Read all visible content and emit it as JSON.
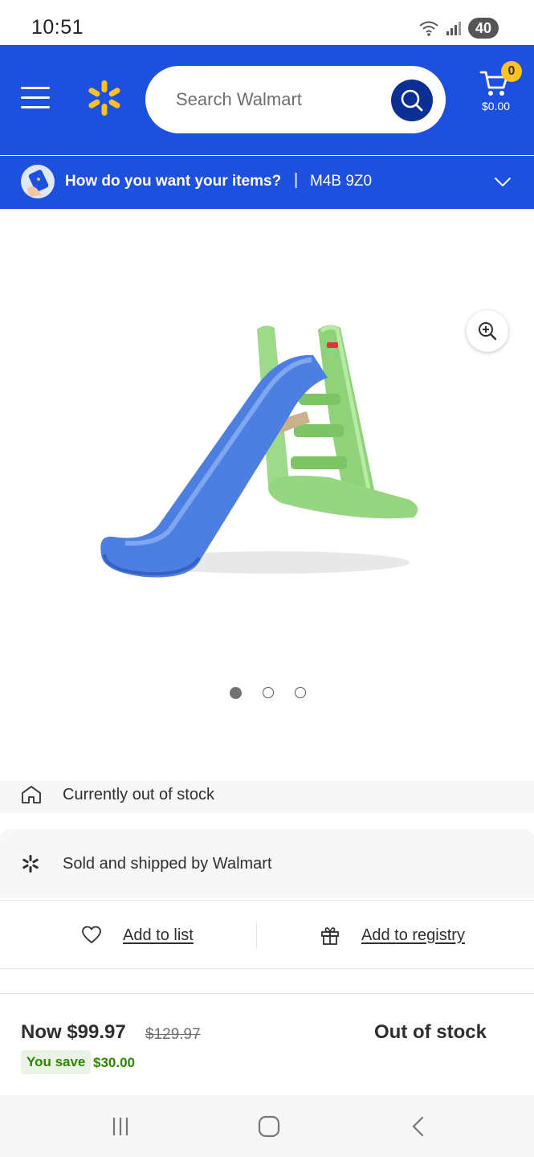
{
  "status_bar": {
    "time": "10:51",
    "battery": "40"
  },
  "header": {
    "search_placeholder": "Search Walmart",
    "cart_count": "0",
    "cart_total": "$0.00"
  },
  "delivery": {
    "question": "How do you want your items?",
    "separator": "|",
    "postal_code": "M4B 9Z0"
  },
  "gallery": {
    "image_count": 3,
    "active_index": 0
  },
  "fulfillment": {
    "stock_status": "Currently out of stock",
    "seller": "Sold and shipped by Walmart"
  },
  "actions": {
    "add_to_list": "Add to list",
    "add_to_registry": "Add to registry"
  },
  "price": {
    "now": "Now $99.97",
    "was": "$129.97",
    "save_label": "You save",
    "save_amount": "$30.00",
    "availability": "Out of stock"
  },
  "colors": {
    "brand_blue": "#1e50e0",
    "search_button": "#0b2f93",
    "spark_yellow": "#ffc220",
    "savings_green": "#2a8703"
  },
  "icons": {
    "menu": "hamburger-icon",
    "logo": "walmart-spark-icon",
    "search": "search-icon",
    "cart": "cart-icon",
    "zoom": "zoom-in-icon",
    "store": "store-icon",
    "seller": "spark-icon",
    "list": "heart-icon",
    "registry": "gift-icon"
  }
}
